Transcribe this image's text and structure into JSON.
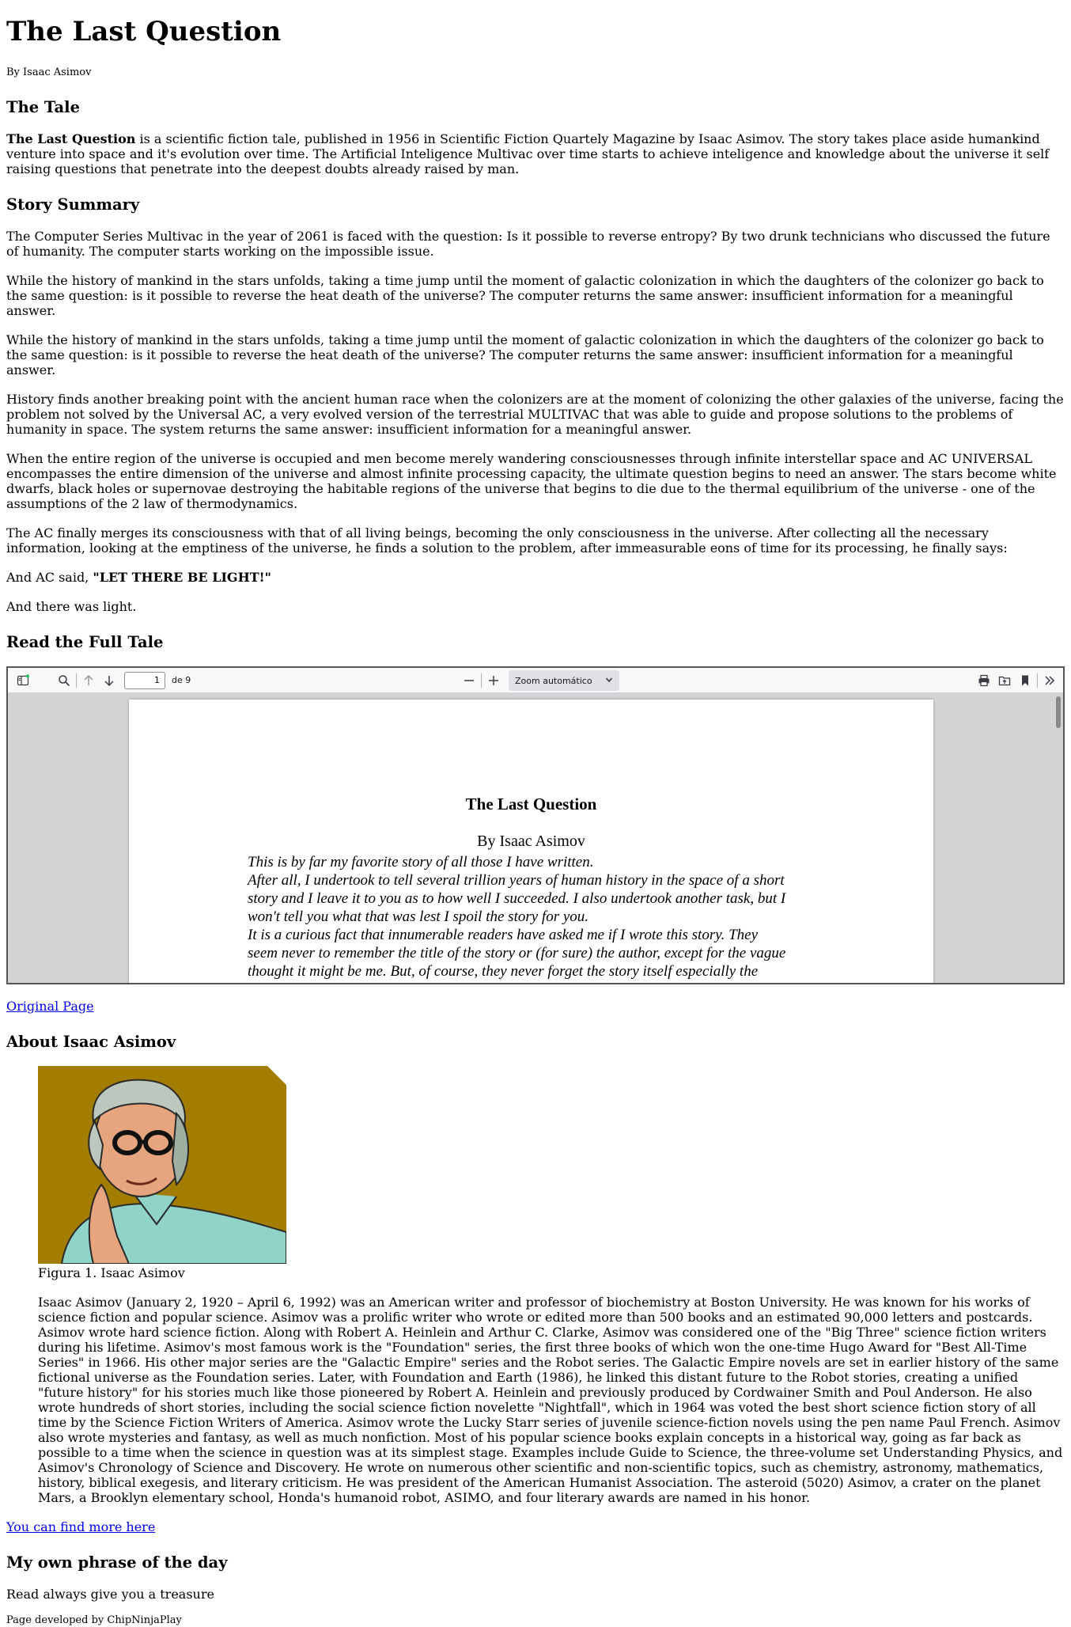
{
  "header": {
    "title": "The Last Question",
    "author_line": "By Isaac Asimov"
  },
  "tale": {
    "heading": "The Tale",
    "intro_bold": "The Last Question",
    "intro_rest": " is a scientific fiction tale, published in 1956 in Scientific Fiction Quartely Magazine by Isaac Asimov. The story takes place aside humankind venture into space and it's evolution over time. The Artificial Inteligence Multivac over time starts to achieve inteligence and knowledge about the universe it self raising questions that penetrate into the deepest doubts already raised by man."
  },
  "summary": {
    "heading": "Story Summary",
    "paragraphs": [
      "The Computer Series Multivac in the year of 2061 is faced with the question: Is it possible to reverse entropy? By two drunk technicians who discussed the future of humanity. The computer starts working on the impossible issue.",
      "While the history of mankind in the stars unfolds, taking a time jump until the moment of galactic colonization in which the daughters of the colonizer go back to the same question: is it possible to reverse the heat death of the universe? The computer returns the same answer: insufficient information for a meaningful answer.",
      "While the history of mankind in the stars unfolds, taking a time jump until the moment of galactic colonization in which the daughters of the colonizer go back to the same question: is it possible to reverse the heat death of the universe? The computer returns the same answer: insufficient information for a meaningful answer.",
      "History finds another breaking point with the ancient human race when the colonizers are at the moment of colonizing the other galaxies of the universe, facing the problem not solved by the Universal AC, a very evolved version of the terrestrial MULTIVAC that was able to guide and propose solutions to the problems of humanity in space. The system returns the same answer: insufficient information for a meaningful answer.",
      "When the entire region of the universe is occupied and men become merely wandering consciousnesses through infinite interstellar space and AC UNIVERSAL encompasses the entire dimension of the universe and almost infinite processing capacity, the ultimate question begins to need an answer. The stars become white dwarfs, black holes or supernovae destroying the habitable regions of the universe that begins to die due to the thermal equilibrium of the universe - one of the assumptions of the 2 law of thermodynamics.",
      "The AC finally merges its consciousness with that of all living beings, becoming the only consciousness in the universe. After collecting all the necessary information, looking at the emptiness of the universe, he finds a solution to the problem, after immeasurable eons of time for its processing, he finally says:"
    ],
    "ac_said_prefix": "And AC said, ",
    "ac_said_bold": "\"LET THERE BE LIGHT!\"",
    "ending": "And there was light."
  },
  "full_tale": {
    "heading": "Read the Full Tale",
    "viewer": {
      "page_value": "1",
      "page_of": "de 9",
      "zoom_label": "Zoom automático",
      "icons": {
        "sidebar": "sidebar-toggle-icon",
        "search": "search-icon",
        "prev": "arrow-up-icon",
        "next": "arrow-down-icon",
        "zoom_out": "minus-icon",
        "zoom_in": "plus-icon",
        "print": "print-icon",
        "open": "folder-icon",
        "bookmark": "bookmark-icon",
        "more": "double-chevron-right-icon"
      },
      "document": {
        "title": "The Last Question",
        "author": "By Isaac Asimov",
        "lines": [
          "This is by far my favorite story of all those I have written.",
          "After all, I undertook to tell several trillion years of human history in the space of a short",
          "story and I leave it to you as to how well I succeeded. I also undertook another task, but I",
          "won't tell you what that was lest I spoil the story for you.",
          "It is a curious fact that innumerable readers have asked me if I wrote this story. They",
          "seem never to remember the title of the story or (for sure) the author, except for the vague",
          "thought it might be me. But, of course, they never forget the story itself especially the"
        ]
      }
    },
    "original_link": "Original Page"
  },
  "about": {
    "heading": "About Isaac Asimov",
    "caption": "Figura 1. Isaac Asimov",
    "bio": "Isaac Asimov (January 2, 1920 – April 6, 1992) was an American writer and professor of biochemistry at Boston University. He was known for his works of science fiction and popular science. Asimov was a prolific writer who wrote or edited more than 500 books and an estimated 90,000 letters and postcards. Asimov wrote hard science fiction. Along with Robert A. Heinlein and Arthur C. Clarke, Asimov was considered one of the \"Big Three\" science fiction writers during his lifetime. Asimov's most famous work is the \"Foundation\" series, the first three books of which won the one-time Hugo Award for \"Best All-Time Series\" in 1966. His other major series are the \"Galactic Empire\" series and the Robot series. The Galactic Empire novels are set in earlier history of the same fictional universe as the Foundation series. Later, with Foundation and Earth (1986), he linked this distant future to the Robot stories, creating a unified \"future history\" for his stories much like those pioneered by Robert A. Heinlein and previously produced by Cordwainer Smith and Poul Anderson. He also wrote hundreds of short stories, including the social science fiction novelette \"Nightfall\", which in 1964 was voted the best short science fiction story of all time by the Science Fiction Writers of America. Asimov wrote the Lucky Starr series of juvenile science-fiction novels using the pen name Paul French. Asimov also wrote mysteries and fantasy, as well as much nonfiction. Most of his popular science books explain concepts in a historical way, going as far back as possible to a time when the science in question was at its simplest stage. Examples include Guide to Science, the three-volume set Understanding Physics, and Asimov's Chronology of Science and Discovery. He wrote on numerous other scientific and non-scientific topics, such as chemistry, astronomy, mathematics, history, biblical exegesis, and literary criticism. He was president of the American Humanist Association. The asteroid (5020) Asimov, a crater on the planet Mars, a Brooklyn elementary school, Honda's humanoid robot, ASIMO, and four literary awards are named in his honor.",
    "more_link": "You can find more here",
    "colors": {
      "portrait_bg": "#a37d00",
      "shirt": "#8fd3c9"
    }
  },
  "phrase": {
    "heading": "My own phrase of the day",
    "text": "Read always give you a treasure"
  },
  "footer": {
    "text": "Page developed by ChipNinjaPlay"
  }
}
